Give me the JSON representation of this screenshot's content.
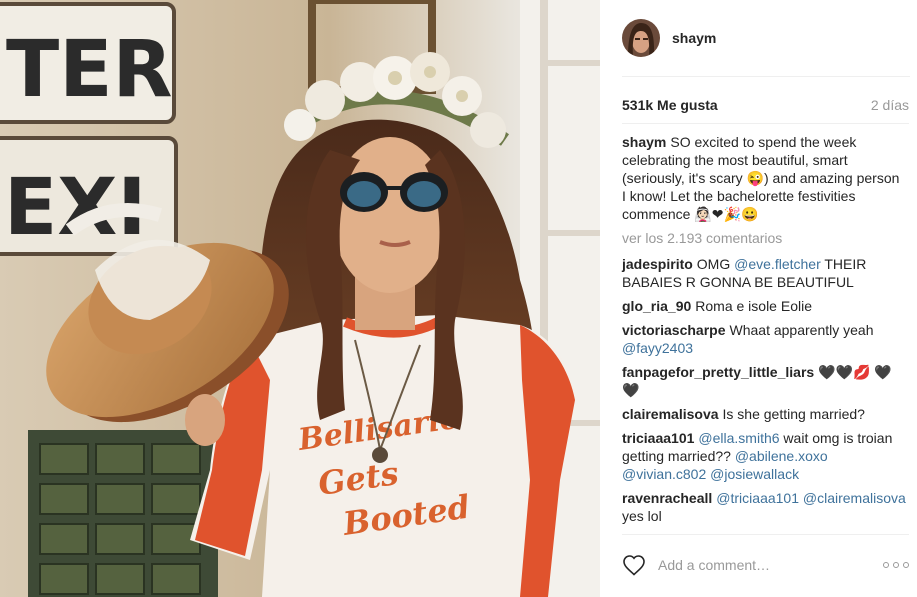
{
  "post": {
    "username": "shaym",
    "likes": "531k Me gusta",
    "time_ago": "2 días",
    "caption": {
      "author": "shaym",
      "text": "SO excited to spend the week celebrating the most beautiful, smart (seriously, it's scary 😜) and amazing person I know! Let the bachelorette festivities commence 👰🏻❤🎉😀"
    },
    "view_all_comments": "ver los 2.193 comentarios",
    "photo": {
      "sign_top_text": "TER",
      "sign_bottom_text": "EXI",
      "shirt_text_1": "Bellisario",
      "shirt_text_2": "Gets",
      "shirt_text_3": "Booted"
    }
  },
  "comments": [
    {
      "author": "jadespirito",
      "parts": [
        {
          "t": "OMG "
        },
        {
          "t": "@eve.fletcher",
          "m": true
        },
        {
          "t": " THEIR BABAIES R GONNA BE BEAUTIFUL"
        }
      ]
    },
    {
      "author": "glo_ria_90",
      "parts": [
        {
          "t": "Roma e isole Eolie"
        }
      ]
    },
    {
      "author": "victoriascharpe",
      "parts": [
        {
          "t": "Whaat apparently yeah "
        },
        {
          "t": "@fayy2403",
          "m": true
        }
      ]
    },
    {
      "author": "fanpagefor_pretty_little_liars",
      "parts": [
        {
          "t": "🖤🖤💋 🖤🖤"
        }
      ]
    },
    {
      "author": "clairemalisova",
      "parts": [
        {
          "t": "Is she getting married?"
        }
      ]
    },
    {
      "author": "triciaaa101",
      "parts": [
        {
          "t": "@ella.smith6",
          "m": true
        },
        {
          "t": " wait omg is troian getting married?? "
        },
        {
          "t": "@abilene.xoxo",
          "m": true
        },
        {
          "t": " "
        },
        {
          "t": "@vivian.c802",
          "m": true
        },
        {
          "t": " "
        },
        {
          "t": "@josiewallack",
          "m": true
        }
      ]
    },
    {
      "author": "ravenracheall",
      "parts": [
        {
          "t": "@triciaaa101",
          "m": true
        },
        {
          "t": " "
        },
        {
          "t": "@clairemalisova",
          "m": true
        },
        {
          "t": " yes lol"
        }
      ]
    }
  ],
  "composer": {
    "placeholder": "Add a comment…"
  },
  "colors": {
    "mention": "#3f729b",
    "muted": "#999999",
    "text": "#262626"
  },
  "icons": {
    "like": "heart-outline-icon",
    "more": "ellipsis-icon"
  }
}
